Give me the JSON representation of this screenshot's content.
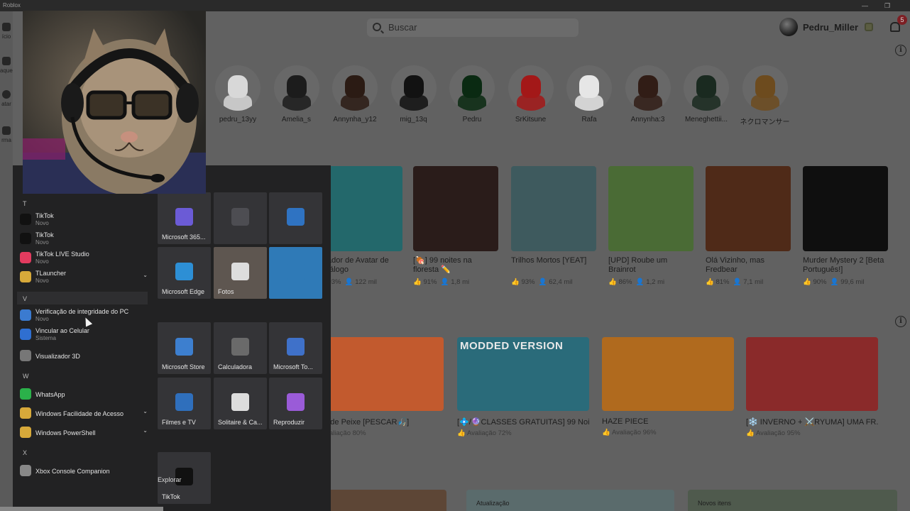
{
  "window": {
    "title": "Roblox"
  },
  "sidebar": {
    "items": [
      {
        "label": "ício",
        "icon": "home-icon"
      },
      {
        "label": "aques",
        "icon": "charts-icon"
      },
      {
        "label": "atar",
        "icon": "avatar-icon"
      },
      {
        "label": "rma",
        "icon": "group-icon"
      }
    ]
  },
  "header": {
    "search_placeholder": "Buscar",
    "username": "Pedru_Miller",
    "notification_count": "5"
  },
  "friends": [
    {
      "name": "pedru_13yy",
      "color": "#d8d8d8"
    },
    {
      "name": "Amelia_s",
      "color": "#1c1c1c"
    },
    {
      "name": "Annynha_y12",
      "color": "#2b1b14"
    },
    {
      "name": "mig_13q",
      "color": "#121212"
    },
    {
      "name": "Pedru",
      "color": "#0a2a12"
    },
    {
      "name": "SrKitsune",
      "color": "#a31818"
    },
    {
      "name": "Rafa",
      "color": "#e6e6e6"
    },
    {
      "name": "Annynha:3",
      "color": "#311d16"
    },
    {
      "name": "Meneghettii...",
      "color": "#1a2a20"
    },
    {
      "name": "ネクロマンサー",
      "color": "#6d4b1e"
    }
  ],
  "games": [
    {
      "title": "Criador de Avatar de Catálogo",
      "rating": "93%",
      "players": "122 mil",
      "bg": "#23686b"
    },
    {
      "title": "[🍖] 99 noites na floresta ✏️",
      "rating": "91%",
      "players": "1,8 mi",
      "bg": "#2a1c1a"
    },
    {
      "title": "Trilhos Mortos [YEAT]",
      "rating": "93%",
      "players": "62,4 mil",
      "bg": "#3e5a5e"
    },
    {
      "title": "[UPD] Roube um Brainrot",
      "rating": "86%",
      "players": "1,2 mi",
      "bg": "#4a6b35"
    },
    {
      "title": "Olá Vizinho, mas Fredbear",
      "rating": "81%",
      "players": "7,1 mil",
      "bg": "#4f2a18"
    },
    {
      "title": "Murder Mystery 2 [Beta Português!]",
      "rating": "90%",
      "players": "99,6 mil",
      "bg": "#0f0f0f"
    }
  ],
  "wide_games": [
    {
      "title": "ecife de Peixe [PESCAR🎣]",
      "rating": "Avaliação 80%",
      "banner": ""
    },
    {
      "title": "[💠/🔮CLASSES GRATUITAS] 99 Noit...",
      "rating": "Avaliação 72%",
      "banner": "MODDED VERSION"
    },
    {
      "title": "HAZE PIECE",
      "rating": "Avaliação 96%",
      "banner": ""
    },
    {
      "title": "[❄️ INVERNO + ⚔️RYUMA] UMA FR...",
      "rating": "Avaliação 95%",
      "banner": ""
    }
  ],
  "bottom_strips": [
    {
      "label": ""
    },
    {
      "label": "Atualização"
    },
    {
      "label": "Novos itens"
    }
  ],
  "startmenu": {
    "letters": {
      "t": "T",
      "v": "V",
      "w": "W",
      "x": "X"
    },
    "apps": [
      {
        "name": "TikTok",
        "sub": "Novo",
        "icon": "tiktok-icon",
        "color": "#111"
      },
      {
        "name": "TikTok",
        "sub": "Novo",
        "icon": "tiktok-icon",
        "color": "#111"
      },
      {
        "name": "TikTok LIVE Studio",
        "sub": "Novo",
        "icon": "tiktok-live-icon",
        "color": "#e23b5f"
      },
      {
        "name": "TLauncher",
        "sub": "Novo",
        "icon": "folder-icon",
        "color": "#d7a93a"
      },
      {
        "name": "Verificação de integridade do PC",
        "sub": "Novo",
        "icon": "pc-health-icon",
        "color": "#3b7bd0"
      },
      {
        "name": "Vincular ao Celular",
        "sub": "Sistema",
        "icon": "phone-link-icon",
        "color": "#2f6fd1"
      },
      {
        "name": "Visualizador 3D",
        "sub": "",
        "icon": "cube-icon",
        "color": "#777"
      },
      {
        "name": "WhatsApp",
        "sub": "",
        "icon": "whatsapp-icon",
        "color": "#2bb14a"
      },
      {
        "name": "Windows Facilidade de Acesso",
        "sub": "",
        "icon": "folder-icon",
        "color": "#d7a93a"
      },
      {
        "name": "Windows PowerShell",
        "sub": "",
        "icon": "folder-icon",
        "color": "#d7a93a"
      },
      {
        "name": "Xbox Console Companion",
        "sub": "",
        "icon": "xbox-icon",
        "color": "#888"
      }
    ],
    "tiles": [
      {
        "label": "Microsoft 365...",
        "icon": "m365-icon",
        "color": "#6b5bd6"
      },
      {
        "label": "",
        "icon": "office-group-icon",
        "color": "#4d4d52"
      },
      {
        "label": "",
        "icon": "outlook-icon",
        "color": "#2f73c2"
      },
      {
        "label": "Microsoft Edge",
        "icon": "edge-icon",
        "color": "#2d8fd5"
      },
      {
        "label": "Fotos",
        "icon": "photos-icon",
        "color": "#ddd"
      },
      {
        "label": "",
        "icon": "linkedin-icon",
        "color": "#2f7ab7"
      },
      {
        "label": "Microsoft Store",
        "icon": "store-icon",
        "color": "#3d7fcf"
      },
      {
        "label": "Calculadora",
        "icon": "calculator-icon",
        "color": "#6a6a6a"
      },
      {
        "label": "Microsoft To...",
        "icon": "todo-icon",
        "color": "#3f71c9"
      },
      {
        "label": "Filmes e TV",
        "icon": "movies-icon",
        "color": "#2f6fbc"
      },
      {
        "label": "Solitaire & Ca...",
        "icon": "cards-icon",
        "color": "#ddd"
      },
      {
        "label": "Reproduzir",
        "icon": "play-icon",
        "color": "#9a5bd8"
      },
      {
        "label": "TikTok",
        "icon": "tiktok-icon",
        "color": "#111"
      }
    ],
    "explorar": "Explorar"
  }
}
